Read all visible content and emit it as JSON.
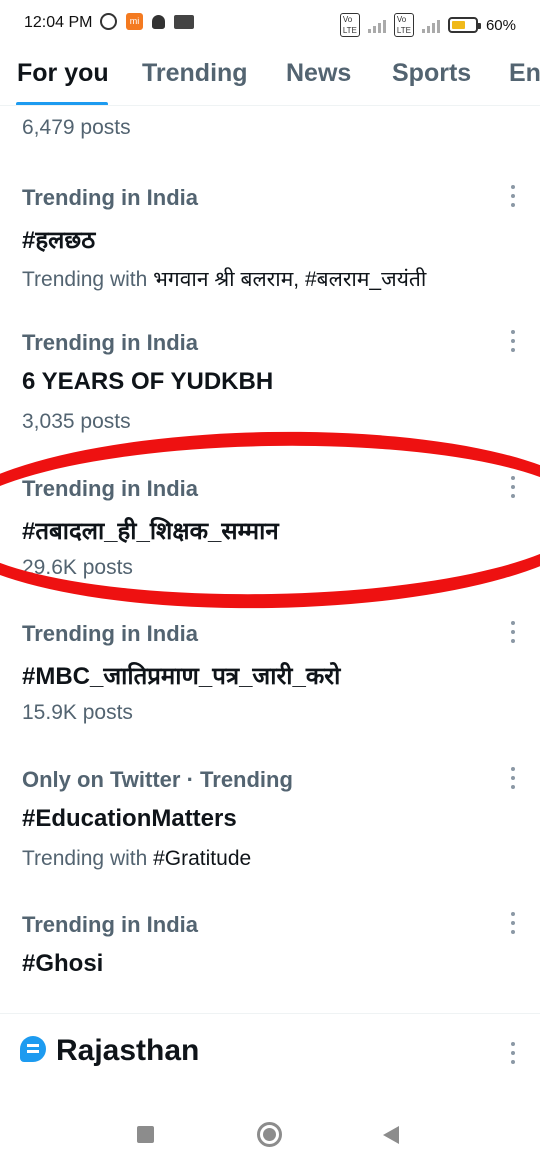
{
  "status_bar": {
    "time": "12:04 PM",
    "battery_percent": "60%",
    "battery_level": 0.6,
    "battery_color": "#f0b91a",
    "volte_label": "Vo LTE",
    "icons": [
      "alarm-icon",
      "mi-icon",
      "bell-icon",
      "news-icon",
      "signal-icon",
      "battery-icon"
    ]
  },
  "tabs": [
    {
      "label": "For you",
      "active": true
    },
    {
      "label": "Trending",
      "active": false
    },
    {
      "label": "News",
      "active": false
    },
    {
      "label": "Sports",
      "active": false
    },
    {
      "label": "En",
      "active": false
    }
  ],
  "feed": {
    "partial_count": "6,479 posts",
    "trends": [
      {
        "context": "Trending in India",
        "title": "#हलछठ",
        "meta_prefix": "Trending with ",
        "meta_value": "भगवान श्री बलराम, #बलराम_जयंती"
      },
      {
        "context": "Trending in India",
        "title": "6 YEARS OF YUDKBH",
        "meta_prefix": "3,035 posts",
        "meta_value": ""
      },
      {
        "context": "Trending in India",
        "title": "#तबादला_ही_शिक्षक_सम्मान",
        "meta_prefix": "29.6K posts",
        "meta_value": ""
      },
      {
        "context": "Trending in India",
        "title": "#MBC_जातिप्रमाण_पत्र_जारी_करो",
        "meta_prefix": "15.9K posts",
        "meta_value": ""
      },
      {
        "context": "Only on Twitter · Trending",
        "title": "#EducationMatters",
        "meta_prefix": "Trending with ",
        "meta_value": "#Gratitude"
      },
      {
        "context": "Trending in India",
        "title": "#Ghosi",
        "meta_prefix": "",
        "meta_value": ""
      }
    ]
  },
  "section": {
    "title": "Rajasthan",
    "icon": "location-icon"
  },
  "colors": {
    "accent": "#1d9bf0",
    "highlight_oval": "#ee1111",
    "muted_text": "#536471"
  }
}
